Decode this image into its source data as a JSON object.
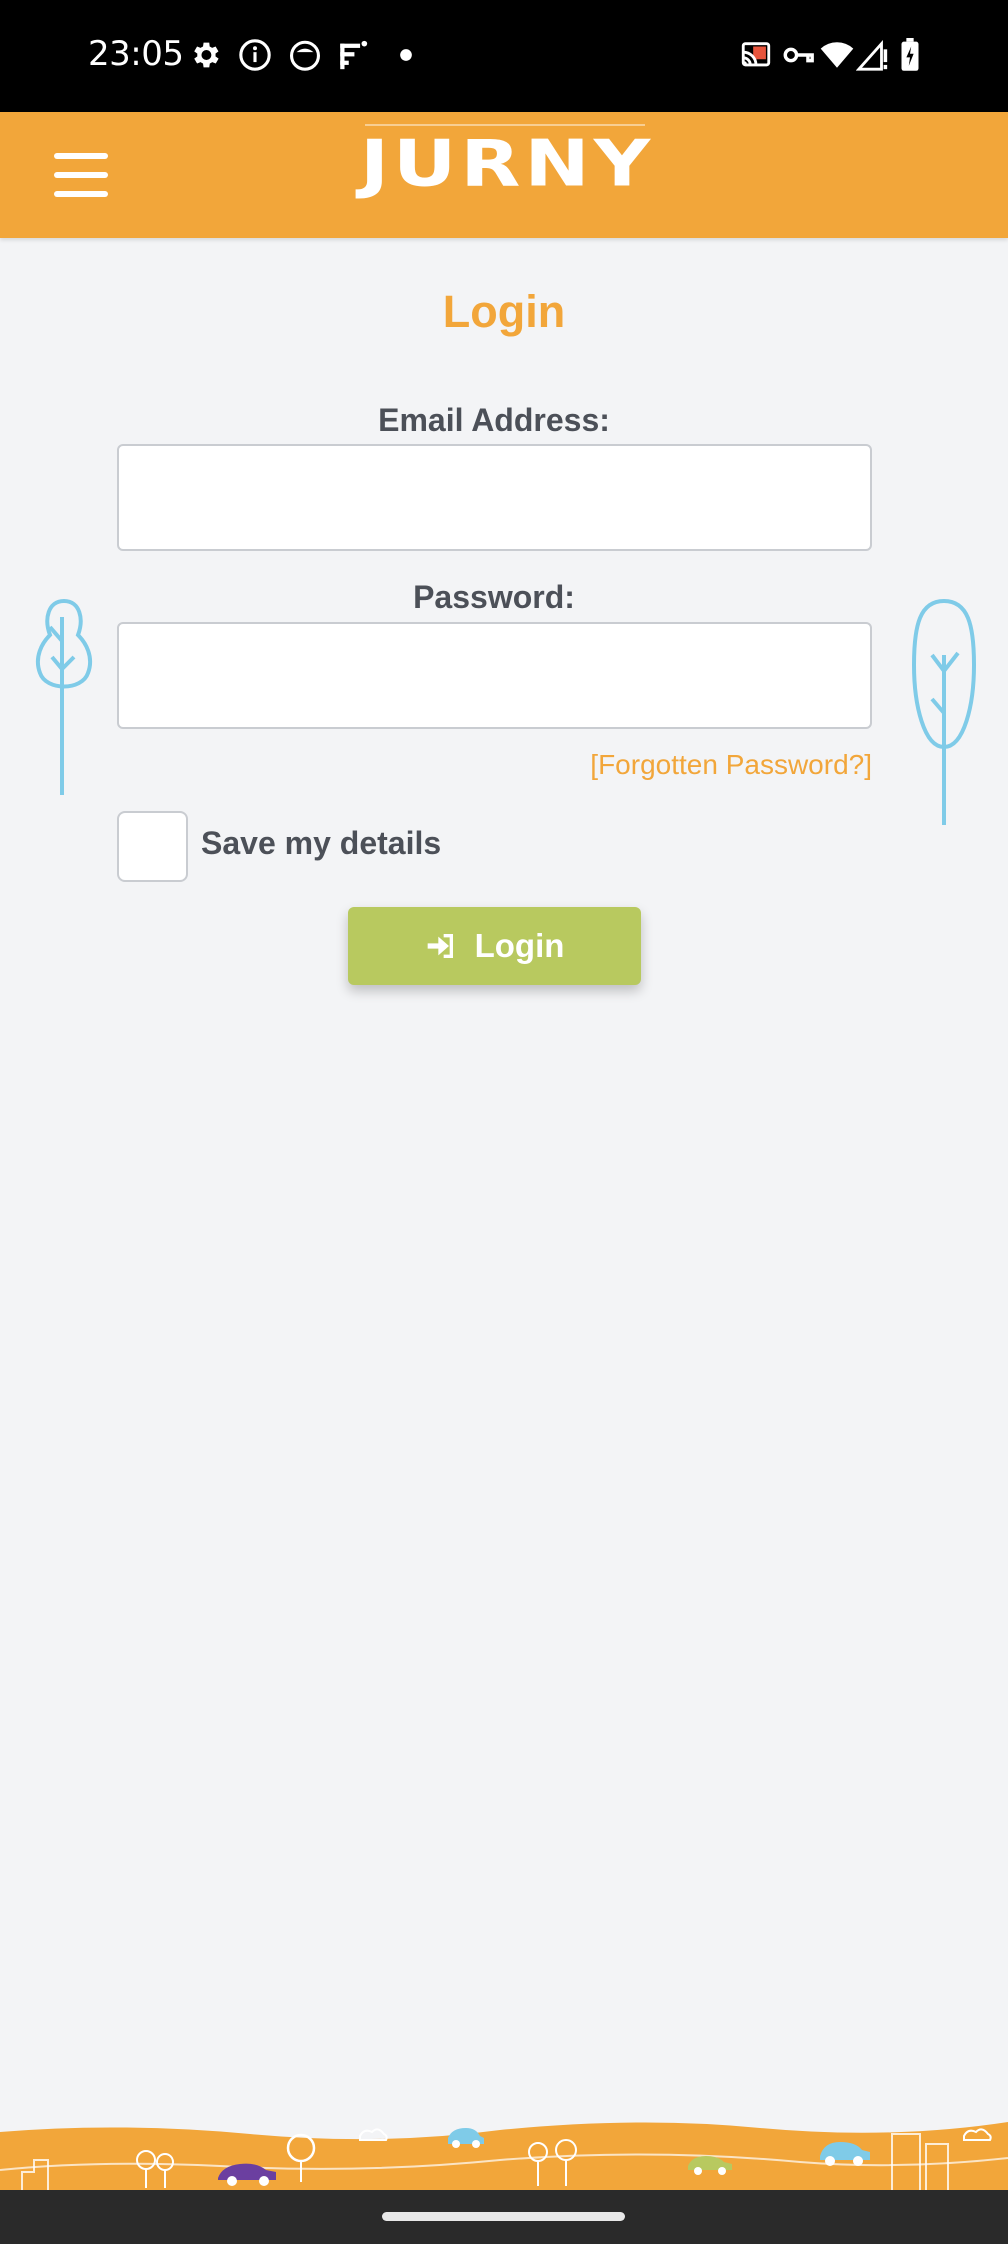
{
  "status_bar": {
    "time": "23:05",
    "left_icons": [
      "settings-icon",
      "info-icon",
      "cat-face-icon",
      "signal-app-icon",
      "dot-icon"
    ],
    "right_icons": [
      "cast-icon",
      "vpn-key-icon",
      "wifi-icon",
      "cell-signal-icon",
      "battery-charging-icon"
    ]
  },
  "header": {
    "logo_text": "JURNY",
    "menu_icon": "hamburger-menu-icon",
    "background_color": "#f2a63a"
  },
  "login_form": {
    "title": "Login",
    "email_label": "Email Address:",
    "email_value": "",
    "password_label": "Password:",
    "password_value": "",
    "forgot_password_link": "[Forgotten Password?]",
    "save_details_label": "Save my details",
    "save_details_checked": false,
    "submit_label": "Login",
    "submit_icon": "sign-in-icon",
    "button_color": "#b8c95f",
    "accent_color": "#f2a63a"
  },
  "decorations": {
    "tree_color": "#7fcbe8",
    "footer_color": "#f2a63a"
  }
}
